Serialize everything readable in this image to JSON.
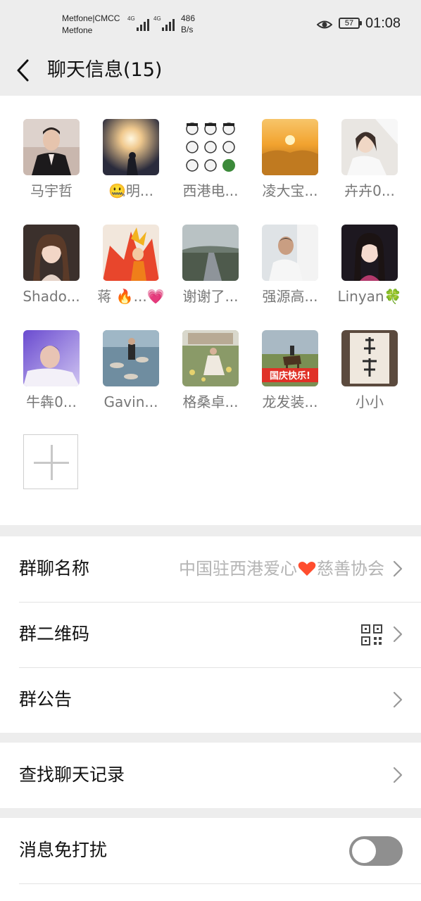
{
  "status_bar": {
    "carrier_line1": "Metfone|CMCC",
    "carrier_line2": "Metfone",
    "network1": "4G",
    "network2": "4G",
    "speed_value": "486",
    "speed_unit": "B/s",
    "battery": "57",
    "time": "01:08"
  },
  "header": {
    "title": "聊天信息(15)"
  },
  "members": [
    {
      "name": "马宇哲",
      "avatar": "man-suit-photo"
    },
    {
      "name": "🤐明...",
      "avatar": "sunburst-photo"
    },
    {
      "name": "西港电...",
      "avatar": "meme-grid"
    },
    {
      "name": "凌大宝...",
      "avatar": "wheat-sunset-photo"
    },
    {
      "name": "卉卉0...",
      "avatar": "girl-bed-photo"
    },
    {
      "name": "Shado...",
      "avatar": "girl-smile-photo"
    },
    {
      "name": "蒋 🔥...💗",
      "avatar": "anime-fire-photo"
    },
    {
      "name": "谢谢了...",
      "avatar": "highway-photo"
    },
    {
      "name": "强源高...",
      "avatar": "man-sofa-photo"
    },
    {
      "name": "Linyan🍀",
      "avatar": "girl-portrait-photo"
    },
    {
      "name": "牛犇0...",
      "avatar": "man-lying-photo"
    },
    {
      "name": "Gavin...",
      "avatar": "pond-rocks-photo"
    },
    {
      "name": "格桑卓...",
      "avatar": "field-flowers-photo"
    },
    {
      "name": "龙发装...",
      "avatar": "horse-rider-photo"
    },
    {
      "name": "小小",
      "avatar": "calligraphy-photo"
    }
  ],
  "settings": {
    "group_name_label": "群聊名称",
    "group_name_value_left": "中国驻西港爱心",
    "group_name_value_right": "慈善协会",
    "qr_label": "群二维码",
    "notice_label": "群公告",
    "search_label": "查找聊天记录",
    "dnd_label": "消息免打扰",
    "dnd_on": false
  },
  "colors": {
    "background": "#ededed",
    "card": "#ffffff",
    "secondary_text": "#777777",
    "toggle_off": "#8f8f8f",
    "heart": "#ff4d2e"
  }
}
